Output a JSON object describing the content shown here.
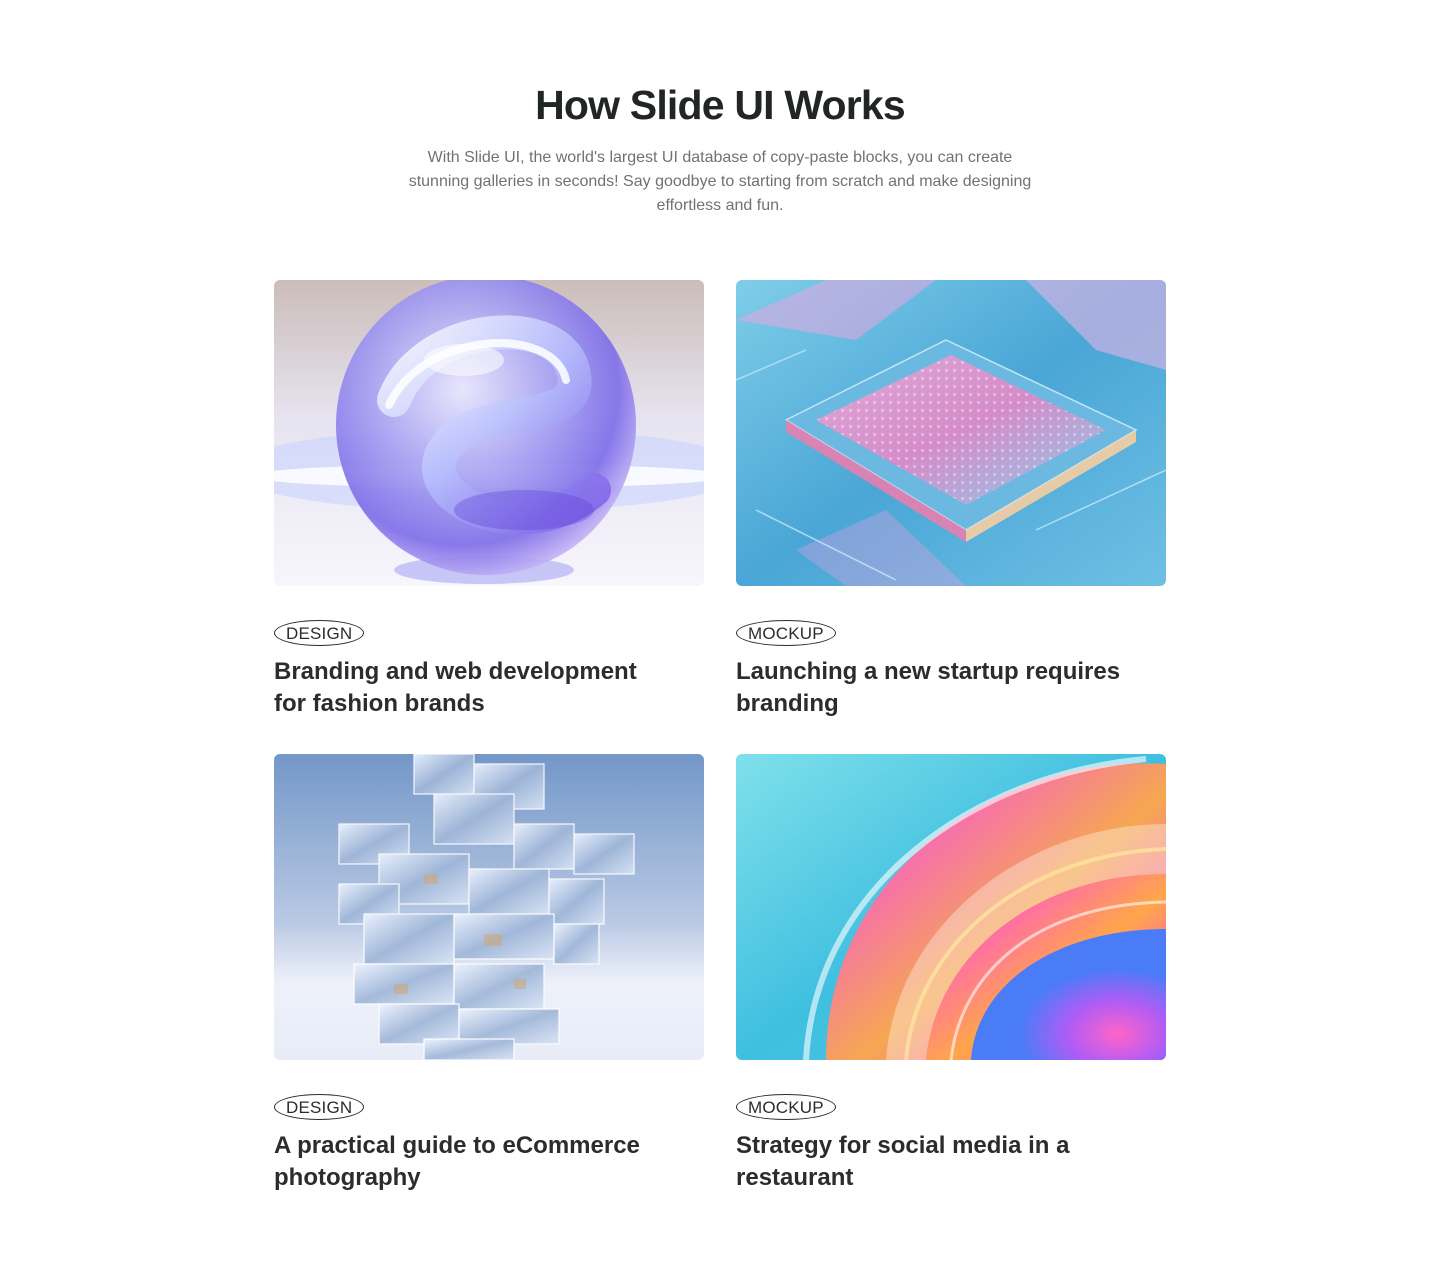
{
  "header": {
    "title": "How Slide UI Works",
    "subtitle": "With Slide UI, the world's largest UI database of copy-paste blocks, you can create stunning galleries in seconds! Say goodbye to starting from scratch and make designing effortless and fun."
  },
  "cards": [
    {
      "tag": "DESIGN",
      "title": "Branding and web development for fashion brands",
      "image": "glass-sphere-image"
    },
    {
      "tag": "MOCKUP",
      "title": "Launching a new startup requires branding",
      "image": "microchip-image"
    },
    {
      "tag": "DESIGN",
      "title": "A practical guide to eCommerce photography",
      "image": "glass-cubes-tower-image"
    },
    {
      "tag": "MOCKUP",
      "title": "Strategy for social media in a restaurant",
      "image": "iridescent-swirl-image"
    }
  ],
  "colors": {
    "heading": "#222526",
    "body_text": "#6f7275",
    "tag_border": "#2a2c2e"
  }
}
